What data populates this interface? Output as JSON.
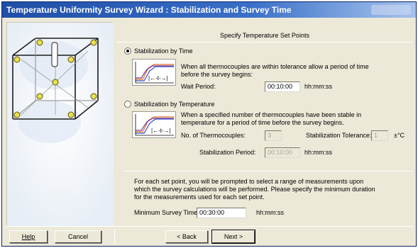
{
  "window": {
    "title": "Temperature Uniformity Survey Wizard : Stabilization and Survey Time"
  },
  "header": "Specify Temperature Set Points",
  "stab_time": {
    "label": "Stabilization by Time",
    "selected": true,
    "desc": [
      "When all thermocouples are within tolerance allow a period of time",
      "before the survey begins:"
    ],
    "wait_label": "Wait Period:",
    "wait_value": "00:10:00",
    "unit": "hh:mm:ss",
    "graph_mark": "|←-t-→|"
  },
  "stab_temp": {
    "label": "Stabilization by Temperature",
    "selected": false,
    "desc": [
      "When a specified number of thermocouples have been stable in",
      "temperature for a period of time before the survey begins."
    ],
    "count_label": "No. of Thermocouples:",
    "count_value": "3",
    "tol_label": "Stabilization Tolerance:",
    "tol_value": "1",
    "tol_unit": "±°C",
    "period_label": "Stabilization Period:",
    "period_value": "00:10:00",
    "unit": "hh:mm:ss",
    "graph_mark": "|←-t-→|"
  },
  "survey": {
    "desc": [
      "For each set point, you will be prompted to select a range of measurements upon",
      "which the survey calculations will be performed. Please specify the minimum duration",
      "for the measurements used for each set point."
    ],
    "min_label": "Minimum Survey Time:",
    "min_value": "00:30:00",
    "unit": "hh:mm:ss"
  },
  "buttons": {
    "help": "Help",
    "cancel": "Cancel",
    "back": "< Back",
    "next": "Next >"
  },
  "colors": {
    "titlebar": "#3a6fc8",
    "dialog": "#ece9d8",
    "graph_line_a": "#e07020",
    "graph_line_b": "#3050c0",
    "graph_line_c": "#7a3aa0"
  },
  "icons": {
    "side": "chamber-thermocouple-diagram",
    "graph": "temperature-curve-graph"
  }
}
